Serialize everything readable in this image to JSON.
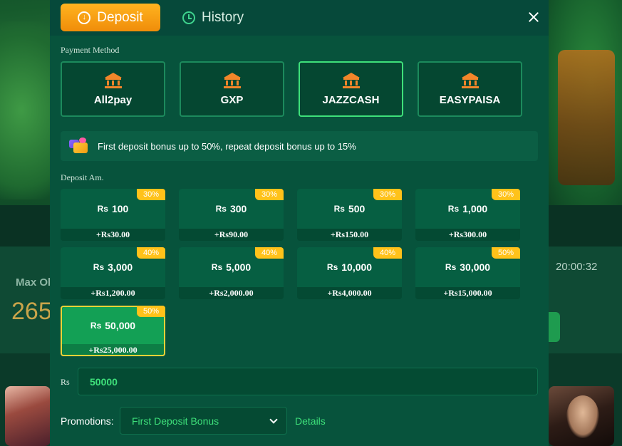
{
  "background": {
    "max_label": "Max Ol",
    "max_value": "265",
    "timer": "20:00:32"
  },
  "header": {
    "tabs": [
      {
        "label": "Deposit",
        "icon": "circle-down-icon",
        "active": true
      },
      {
        "label": "History",
        "icon": "clock-icon",
        "active": false
      }
    ],
    "close_icon": "close-icon"
  },
  "payment": {
    "label": "Payment Method",
    "methods": [
      {
        "name": "All2pay",
        "icon": "bank-icon",
        "active": false
      },
      {
        "name": "GXP",
        "icon": "bank-icon",
        "active": false
      },
      {
        "name": "JAZZCASH",
        "icon": "bank-icon",
        "active": true
      },
      {
        "name": "EASYPAISA",
        "icon": "bank-icon",
        "active": false
      }
    ]
  },
  "bonus": {
    "icon": "gift-icon",
    "text": "First deposit bonus up to 50%, repeat deposit bonus up to 15%"
  },
  "deposit": {
    "label": "Deposit Am.",
    "currency": "Rs",
    "amounts": [
      {
        "value": "100",
        "extra": "+Rs30.00",
        "badge": "30%"
      },
      {
        "value": "300",
        "extra": "+Rs90.00",
        "badge": "30%"
      },
      {
        "value": "500",
        "extra": "+Rs150.00",
        "badge": "30%"
      },
      {
        "value": "1,000",
        "extra": "+Rs300.00",
        "badge": "30%"
      },
      {
        "value": "3,000",
        "extra": "+Rs1,200.00",
        "badge": "40%"
      },
      {
        "value": "5,000",
        "extra": "+Rs2,000.00",
        "badge": "40%"
      },
      {
        "value": "10,000",
        "extra": "+Rs4,000.00",
        "badge": "40%"
      },
      {
        "value": "30,000",
        "extra": "+Rs15,000.00",
        "badge": "50%"
      },
      {
        "value": "50,000",
        "extra": "+Rs25,000.00",
        "badge": "50%",
        "selected": true
      }
    ]
  },
  "input": {
    "currency_label": "Rs",
    "value": "50000"
  },
  "promotions": {
    "label": "Promotions:",
    "selected": "First Deposit Bonus",
    "details_link": "Details"
  },
  "colors": {
    "accent_orange": "#f7a214",
    "accent_green": "#3ee07a",
    "badge_yellow": "#ffc21a",
    "modal_bg": "#07533c"
  }
}
